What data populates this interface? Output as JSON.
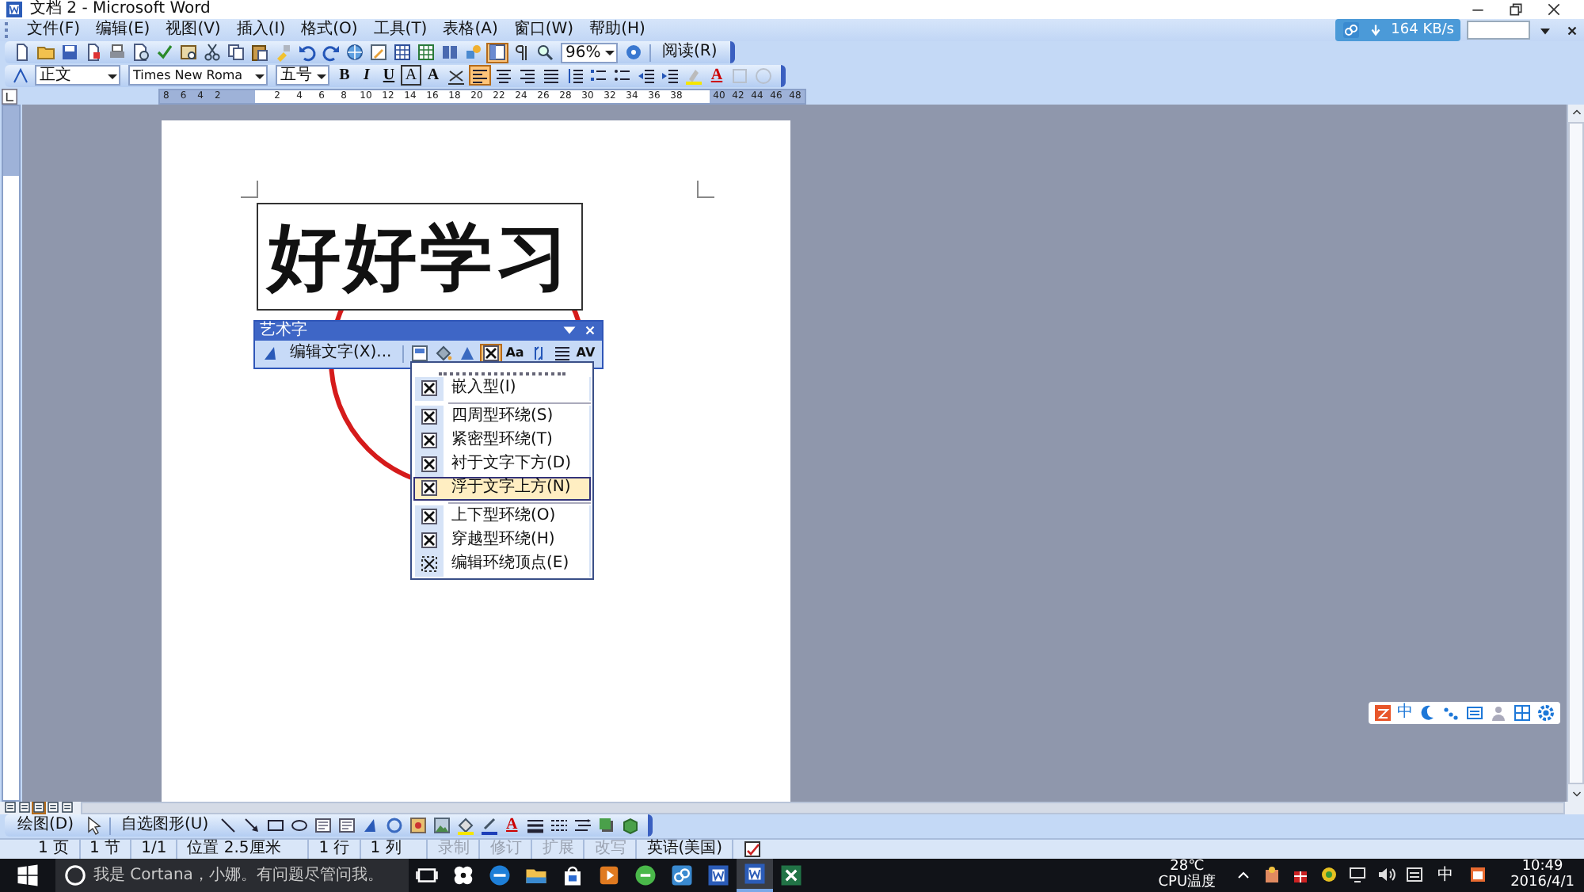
{
  "window": {
    "title": "文档 2 - Microsoft Word"
  },
  "menu_bar": {
    "items": [
      "文件(F)",
      "编辑(E)",
      "视图(V)",
      "插入(I)",
      "格式(O)",
      "工具(T)",
      "表格(A)",
      "窗口(W)",
      "帮助(H)"
    ]
  },
  "download_speed": "164 KB/s",
  "standard_toolbar": {
    "buttons": [
      {
        "pressed": false
      },
      {
        "pressed": false
      },
      {
        "pressed": false
      },
      {
        "pressed": false
      },
      {
        "pressed": false
      },
      {
        "pressed": false
      },
      {
        "pressed": false
      },
      {
        "pressed": false
      },
      {
        "pressed": false
      },
      {
        "pressed": false
      },
      {
        "pressed": false
      },
      {
        "pressed": false
      },
      {
        "pressed": false
      },
      {
        "pressed": false
      },
      {
        "pressed": false
      },
      {
        "pressed": false
      },
      {
        "pressed": false
      },
      {
        "pressed": false
      },
      {
        "pressed": false
      },
      {
        "pressed": false
      },
      {
        "pressed": true
      },
      {
        "pressed": false
      },
      {
        "pressed": false
      }
    ],
    "zoom": "96%",
    "read_button": "阅读(R)"
  },
  "formatting_toolbar": {
    "style": "正文",
    "font": "Times New Roma",
    "size": "五号",
    "buttons": [
      {
        "label": "B",
        "pressed": false
      },
      {
        "label": "I",
        "pressed": false
      },
      {
        "label": "U",
        "pressed": false
      },
      {
        "label": "A",
        "pressed": false
      },
      {
        "label": "A",
        "pressed": false
      },
      {
        "pressed": false
      },
      {
        "pressed": true
      },
      {
        "pressed": false
      },
      {
        "pressed": false
      },
      {
        "pressed": false
      },
      {
        "pressed": false
      },
      {
        "pressed": false
      },
      {
        "pressed": false
      },
      {
        "pressed": false
      },
      {
        "pressed": false
      },
      {
        "pressed": false
      },
      {
        "label": "A",
        "pressed": false
      },
      {
        "pressed": false
      },
      {
        "pressed": false
      }
    ]
  },
  "ruler": {
    "left_numbers": [
      "8",
      "6",
      "4",
      "2"
    ],
    "right_numbers": [
      "2",
      "4",
      "6",
      "8",
      "10",
      "12",
      "14",
      "16",
      "18",
      "20",
      "22",
      "24",
      "26",
      "28",
      "30",
      "32",
      "34",
      "36",
      "38",
      "40",
      "42",
      "44",
      "46",
      "48"
    ]
  },
  "wordart": {
    "text": "好好学习"
  },
  "wordart_toolbar": {
    "title": "艺术字",
    "edit_text": "编辑文字(X)...",
    "buttons": [
      {
        "pressed": false
      },
      {
        "pressed": false
      },
      {
        "pressed": false
      },
      {
        "pressed": true
      },
      {
        "label": "Aa",
        "pressed": false
      },
      {
        "pressed": false
      },
      {
        "pressed": false
      },
      {
        "label": "AV",
        "pressed": false
      }
    ]
  },
  "wrap_menu": {
    "items": [
      {
        "label": "嵌入型(I)",
        "selected": false,
        "separator_after": true
      },
      {
        "label": "四周型环绕(S)",
        "selected": false,
        "separator_after": false
      },
      {
        "label": "紧密型环绕(T)",
        "selected": false,
        "separator_after": false
      },
      {
        "label": "衬于文字下方(D)",
        "selected": false,
        "separator_after": false
      },
      {
        "label": "浮于文字上方(N)",
        "selected": true,
        "separator_after": true
      },
      {
        "label": "上下型环绕(O)",
        "selected": false,
        "separator_after": false
      },
      {
        "label": "穿越型环绕(H)",
        "selected": false,
        "separator_after": false
      },
      {
        "label": "编辑环绕顶点(E)",
        "selected": false,
        "separator_after": false
      }
    ]
  },
  "ime_bar": {
    "mode": "中"
  },
  "view_buttons": [
    {
      "pressed": false
    },
    {
      "pressed": false
    },
    {
      "pressed": true
    },
    {
      "pressed": false
    },
    {
      "pressed": false
    }
  ],
  "drawing_toolbar": {
    "draw_menu": "绘图(D)",
    "autoshapes_menu": "自选图形(U)",
    "font_color": "A"
  },
  "status_bar": {
    "cells": [
      {
        "text": "1 页",
        "disabled": false
      },
      {
        "text": "1 节",
        "disabled": false
      },
      {
        "text": "1/1",
        "disabled": false
      },
      {
        "text": "位置 2.5厘米",
        "disabled": false
      },
      {
        "text": "1 行",
        "disabled": false
      },
      {
        "text": "1 列",
        "disabled": false
      },
      {
        "text": "录制",
        "disabled": true
      },
      {
        "text": "修订",
        "disabled": true
      },
      {
        "text": "扩展",
        "disabled": true
      },
      {
        "text": "改写",
        "disabled": true
      },
      {
        "text": "英语(美国)",
        "disabled": false
      }
    ]
  },
  "taskbar": {
    "search_placeholder": "我是 Cortana，小娜。有问题尽管问我。",
    "apps": [
      {
        "active": false
      },
      {
        "active": false
      },
      {
        "active": false
      },
      {
        "active": false
      },
      {
        "active": false
      },
      {
        "active": false
      },
      {
        "active": false
      },
      {
        "active": false
      },
      {
        "active": false
      },
      {
        "active": true
      },
      {
        "active": false
      }
    ],
    "temperature": "28℃",
    "temperature_label": "CPU温度",
    "ime": "中",
    "time": "10:49",
    "date": "2016/4/1"
  }
}
